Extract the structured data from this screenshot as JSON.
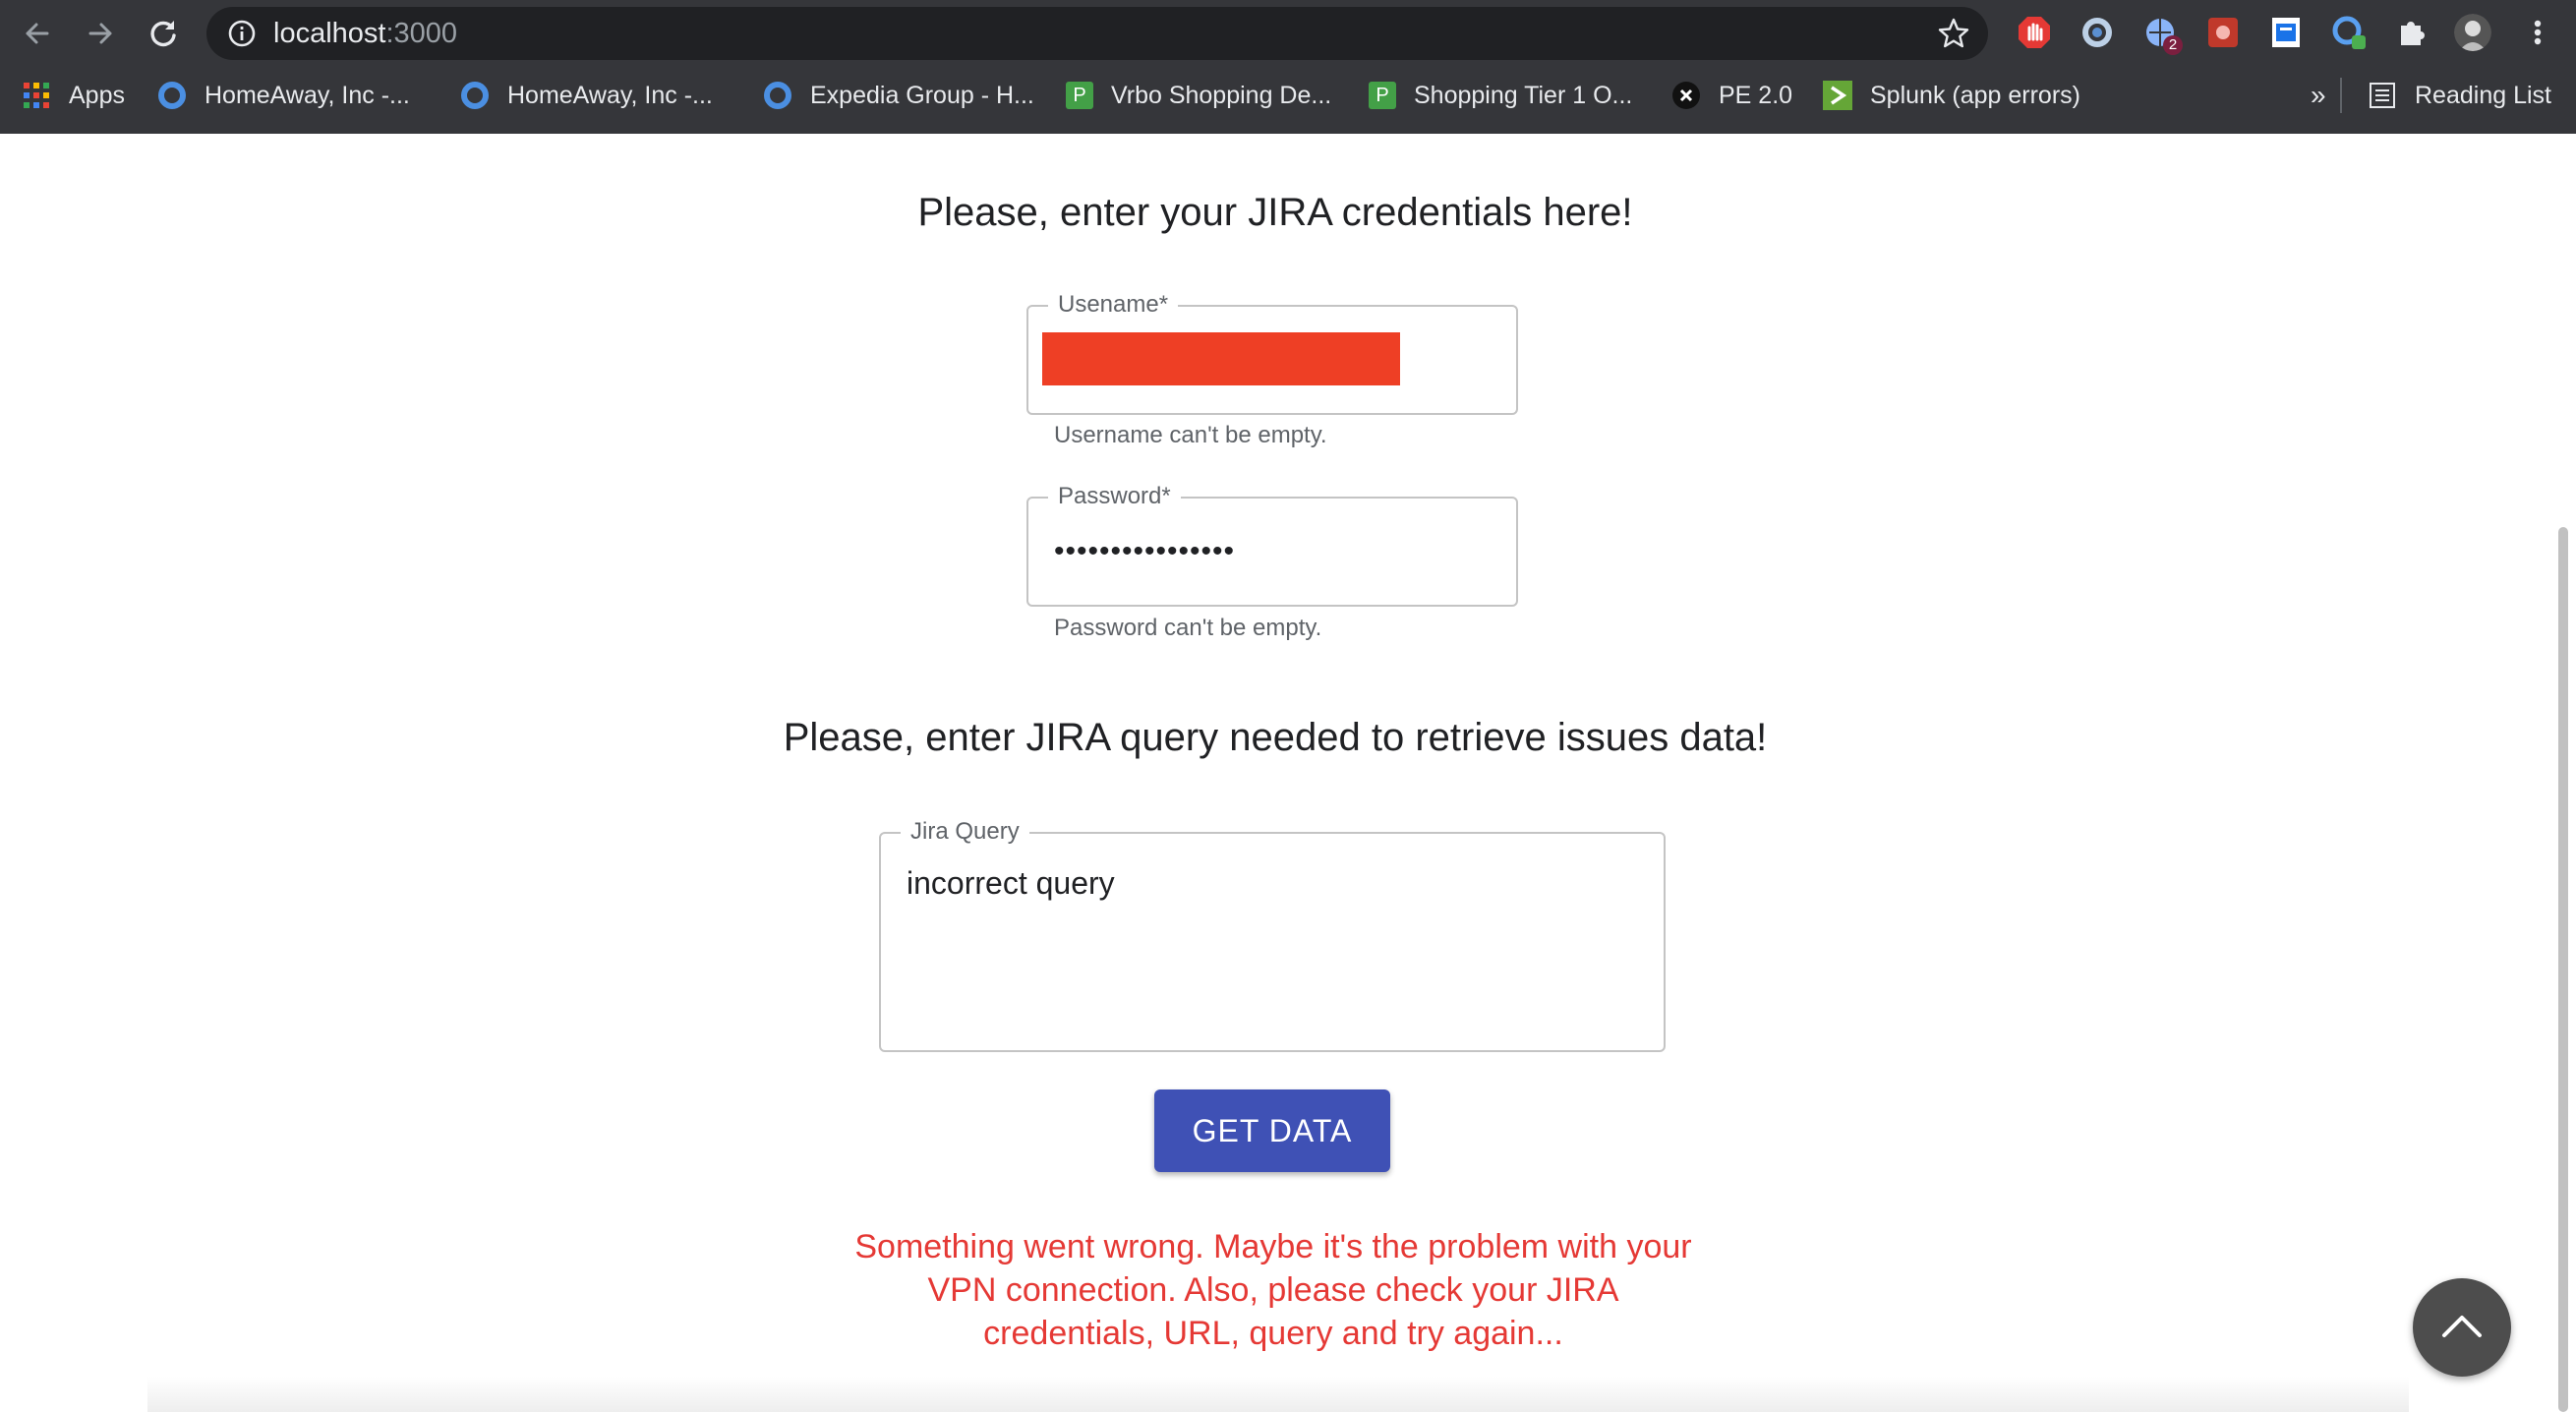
{
  "browser": {
    "url_host": "localhost",
    "url_port": ":3000",
    "extension_badges": {
      "ext2": "2"
    },
    "bookmarks": [
      {
        "label": "Apps",
        "icon": "apps-grid-icon"
      },
      {
        "label": "HomeAway, Inc -...",
        "icon": "circle-icon"
      },
      {
        "label": "HomeAway, Inc -...",
        "icon": "circle-icon"
      },
      {
        "label": "Expedia Group - H...",
        "icon": "circle-icon"
      },
      {
        "label": "Vrbo Shopping De...",
        "icon": "p-square-icon",
        "icon_text": "P"
      },
      {
        "label": "Shopping Tier 1 O...",
        "icon": "p-square-icon",
        "icon_text": "P"
      },
      {
        "label": "PE 2.0",
        "icon": "x-circle-icon"
      },
      {
        "label": "Splunk (app errors)",
        "icon": "splunk-icon"
      }
    ],
    "overflow_label": "»",
    "reading_list_label": "Reading List"
  },
  "form": {
    "credentials_heading": "Please, enter your JIRA credentials here!",
    "username_label": "Usename",
    "required_mark": "*",
    "username_error": "Username can't be empty.",
    "password_label": "Password",
    "password_value": "••••••••••••••••",
    "password_error": "Password can't be empty.",
    "query_heading": "Please, enter JIRA query needed to retrieve issues data!",
    "query_label": "Jira Query",
    "query_value": "incorrect query",
    "submit_label": "GET DATA",
    "error_message": "Something went wrong. Maybe it's the problem with your VPN connection. Also, please check your JIRA credentials, URL, query and try again..."
  },
  "colors": {
    "primary_button": "#3f51b5",
    "error_text": "#e53935",
    "redaction": "#ee3f25"
  }
}
